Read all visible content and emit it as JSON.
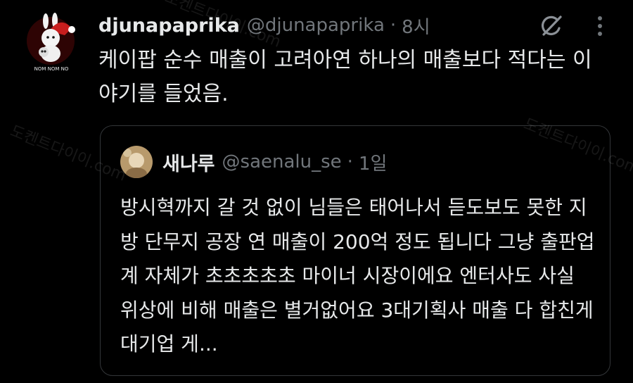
{
  "tweet": {
    "author_name": "djunapaprika",
    "author_handle": "@djunapaprika",
    "separator": "·",
    "time": "8시",
    "avatar_text": "NOM NOM NO",
    "text": "케이팝 순수 매출이 고려아연 하나의 매출보다 적다는 이야기를 들었음."
  },
  "quoted": {
    "author_name": "새나루",
    "author_handle": "@saenalu_se",
    "separator": "·",
    "time": "1일",
    "text": "방시혁까지 갈 것 없이 님들은 태어나서 듣도보도 못한 지방 단무지 공장 연 매출이 200억 정도 됩니다 그냥 출판업계 자체가 초초초초초 마이너 시장이에요 엔터사도 사실 위상에 비해 매출은 별거없어요 3대기획사 매출 다 합친게 대기업 게..."
  },
  "watermark": {
    "text": "도켄트다이이",
    "domain": ".com"
  },
  "icons": {
    "grok": "grok-icon",
    "more": "more-options-icon"
  },
  "colors": {
    "background": "#000000",
    "text": "#e7e9ea",
    "secondary": "#71767b",
    "border": "#333639"
  }
}
